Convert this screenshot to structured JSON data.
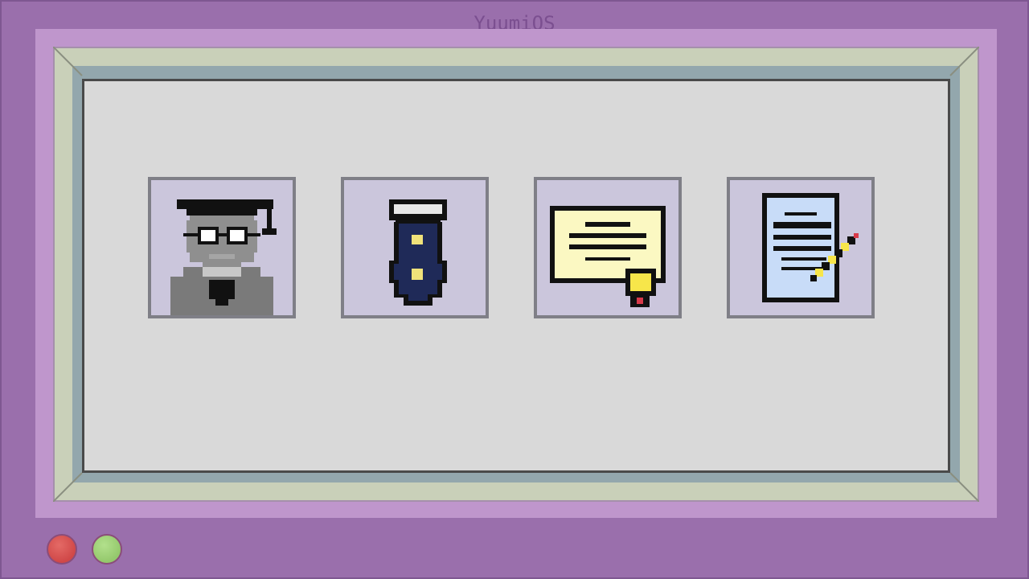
{
  "os": {
    "title": "YuumiOS"
  },
  "colors": {
    "background": "#9a6fac",
    "screen": "#bf96cc",
    "desktop": "#d9d9d9",
    "icon_tile": "#cbc6dc",
    "icon_border": "#7f7f87",
    "red_button": "#d9534f",
    "green_button": "#9fd27a"
  },
  "apps": [
    {
      "icon": "graduate-portrait-icon"
    },
    {
      "icon": "necktie-icon"
    },
    {
      "icon": "diploma-certificate-icon"
    },
    {
      "icon": "document-pencil-icon"
    }
  ],
  "controls": [
    {
      "icon": "red-button"
    },
    {
      "icon": "green-button"
    }
  ]
}
